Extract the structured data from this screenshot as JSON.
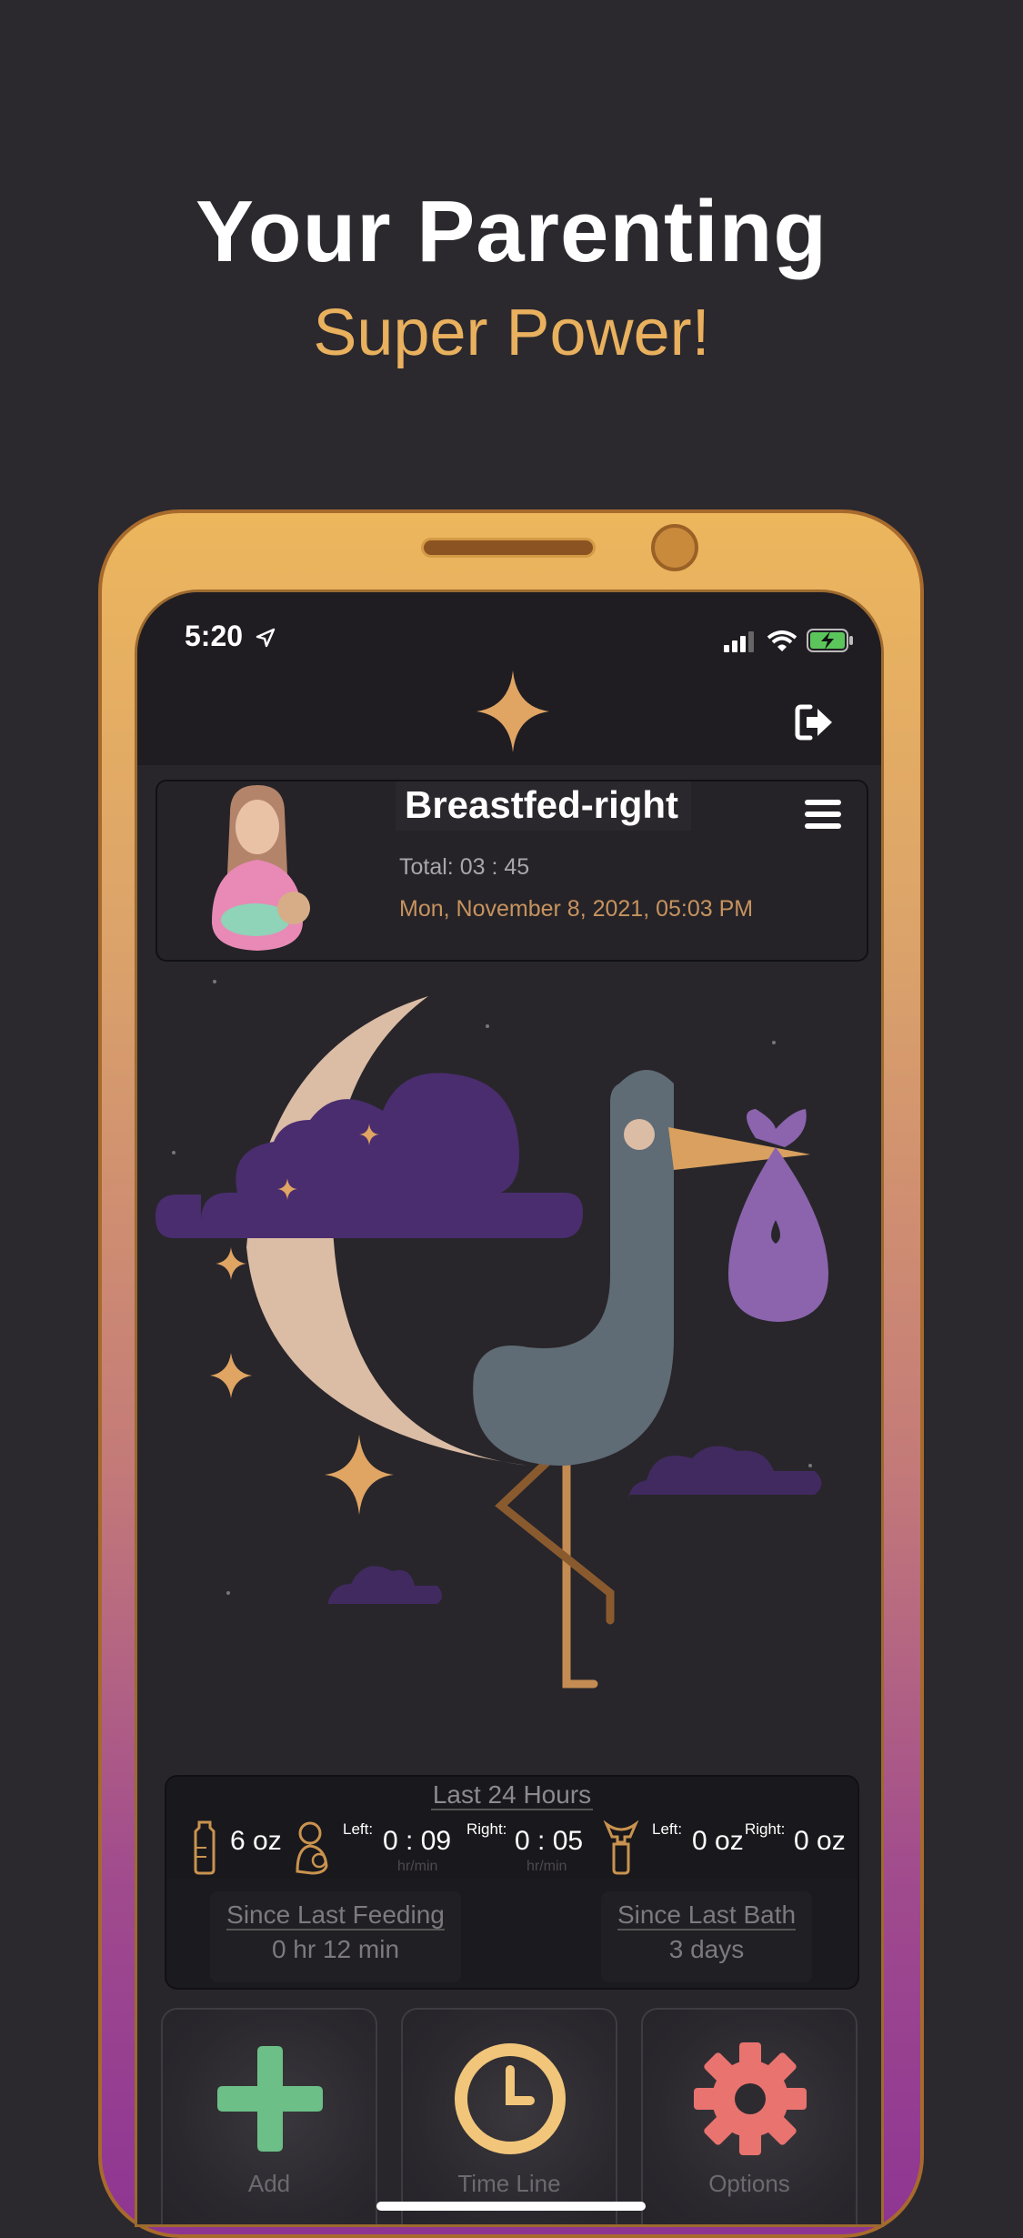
{
  "promo": {
    "headline": "Your Parenting",
    "subheadline": "Super Power!"
  },
  "status_bar": {
    "time": "5:20",
    "icons": [
      "location-arrow-icon",
      "signal-icon",
      "wifi-icon",
      "battery-charging-icon"
    ]
  },
  "header": {
    "logo_icon": "sparkle-icon",
    "logout_icon": "logout-icon"
  },
  "last_activity": {
    "title": "Breastfed-right",
    "total": "Total: 03 : 45",
    "timestamp": "Mon, November 8, 2021, 05:03 PM",
    "menu_icon": "hamburger-menu-icon"
  },
  "last_24_hours": {
    "title": "Last 24 Hours",
    "bottle": "6 oz",
    "nursing_left_label": "Left:",
    "nursing_left_value": "0 : 09",
    "nursing_left_unit": "hr/min",
    "nursing_right_label": "Right:",
    "nursing_right_value": "0 : 05",
    "nursing_right_unit": "hr/min",
    "pump_left_label": "Left:",
    "pump_left_value": "0 oz",
    "pump_right_label": "Right:",
    "pump_right_value": "0 oz"
  },
  "since": {
    "feeding_label": "Since Last Feeding",
    "feeding_value": "0 hr 12 min",
    "bath_label": "Since Last Bath",
    "bath_value": "3 days"
  },
  "actions": [
    {
      "label": "Add",
      "icon": "plus-icon",
      "color": "#6cbf86"
    },
    {
      "label": "Time Line",
      "icon": "clock-icon",
      "color": "#f1c57a"
    },
    {
      "label": "Options",
      "icon": "gear-icon",
      "color": "#e9736f"
    }
  ],
  "colors": {
    "accent_gold": "#e9b05e",
    "background": "#2b292e",
    "cloud_purple": "#4a2d6e"
  }
}
